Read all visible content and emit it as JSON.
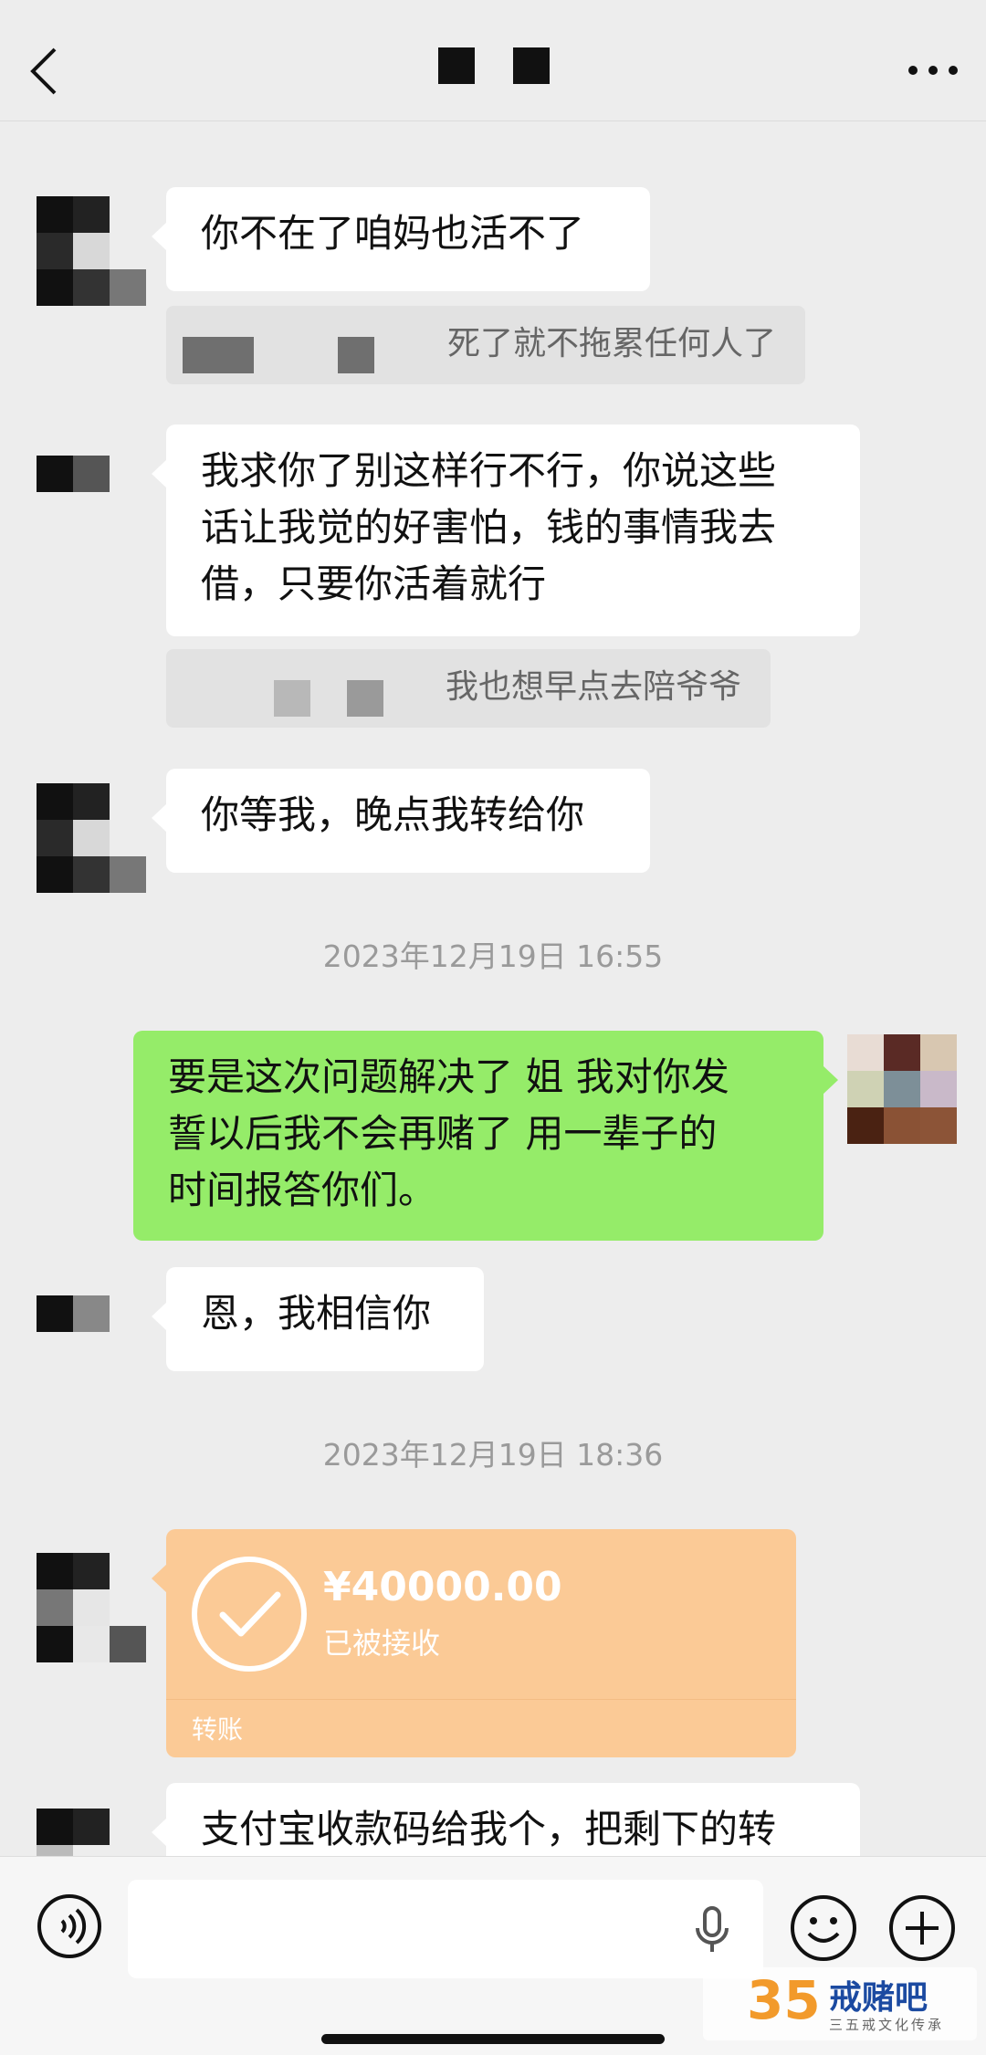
{
  "header": {
    "title": "■ ■"
  },
  "messages": [
    {
      "text": "你不在了咱妈也活不了"
    },
    {
      "quote": "死了就不拖累任何人了"
    },
    {
      "text": "我求你了别这样行不行，你说这些\n话让我觉的好害怕，钱的事情我去\n借，只要你活着就行"
    },
    {
      "quote": "我也想早点去陪爷爷"
    },
    {
      "text": "你等我，晚点我转给你"
    },
    {
      "timestamp": "2023年12月19日 16:55"
    },
    {
      "text": "要是这次问题解决了 姐 我对你发\n誓以后我不会再赌了 用一辈子的\n时间报答你们。"
    },
    {
      "text": "恩，我相信你"
    },
    {
      "timestamp": "2023年12月19日 18:36"
    },
    {
      "transfer": {
        "amount": "¥40000.00",
        "status": "已被接收",
        "kind": "转账"
      }
    },
    {
      "text": "支付宝收款码给我个，把剩下的转"
    }
  ],
  "colors": {
    "background": "#ededed",
    "sent_bubble": "#95ec69",
    "received_bubble": "#ffffff",
    "transfer_card": "#fbca96"
  },
  "icons": [
    "back-arrow-icon",
    "more-dots-icon",
    "voice-icon",
    "mic-icon",
    "emoji-icon",
    "plus-icon",
    "check-icon"
  ],
  "watermark": {
    "number": "35",
    "name": "戒赌吧",
    "slogan": "三五戒文化传承"
  }
}
